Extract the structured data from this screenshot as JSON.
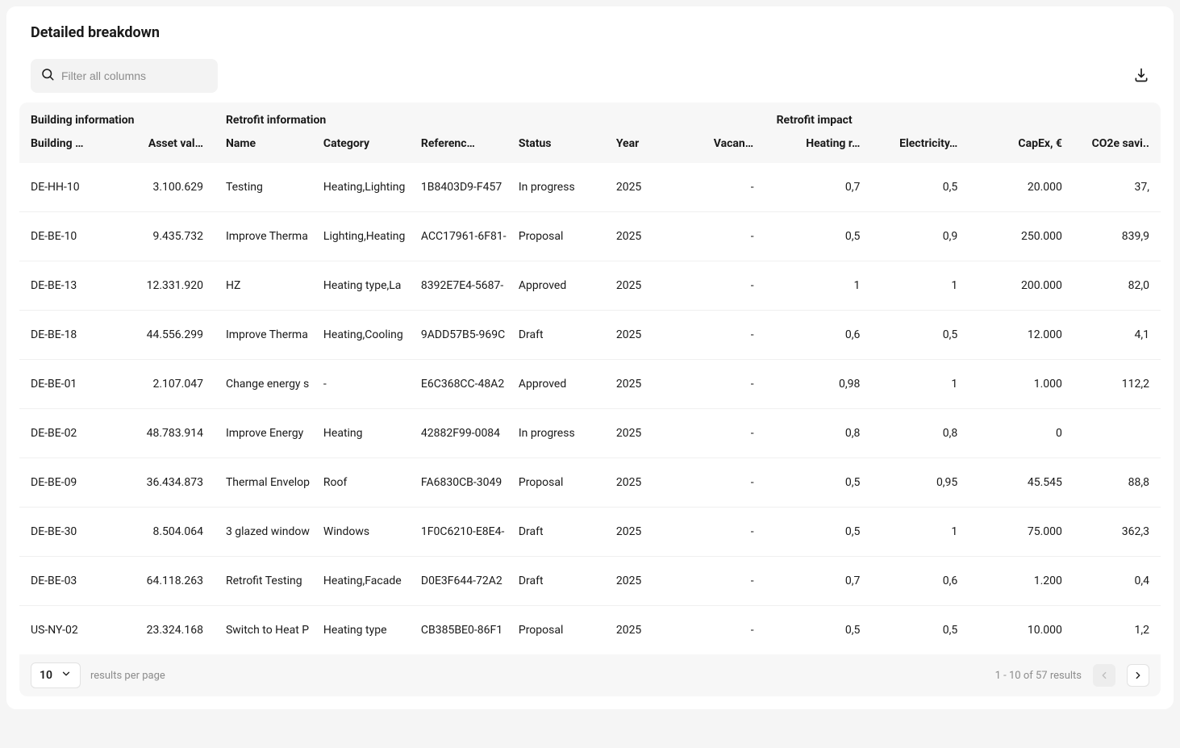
{
  "title": "Detailed breakdown",
  "search": {
    "placeholder": "Filter all columns"
  },
  "groupHeaders": {
    "building": "Building information",
    "retrofit": "Retrofit information",
    "impact": "Retrofit impact"
  },
  "columns": {
    "building": "Building …",
    "asset": "Asset val…",
    "name": "Name",
    "category": "Category",
    "reference": "Referenc…",
    "status": "Status",
    "year": "Year",
    "vacancy": "Vacancy …",
    "heating": "Heating r…",
    "electricity": "Electricity…",
    "capex": "CapEx, €",
    "co2": "CO2e savi.."
  },
  "rows": [
    {
      "building": "DE-HH-10",
      "asset": "3.100.629",
      "name": "Testing",
      "category": "Heating,Lighting",
      "reference": "1B8403D9-F457",
      "status": "In progress",
      "year": "2025",
      "vacancy": "-",
      "heating": "0,7",
      "electricity": "0,5",
      "capex": "20.000",
      "co2": "37,"
    },
    {
      "building": "DE-BE-10",
      "asset": "9.435.732",
      "name": "Improve Therma",
      "category": "Lighting,Heating",
      "reference": "ACC17961-6F81-",
      "status": "Proposal",
      "year": "2025",
      "vacancy": "-",
      "heating": "0,5",
      "electricity": "0,9",
      "capex": "250.000",
      "co2": "839,9"
    },
    {
      "building": "DE-BE-13",
      "asset": "12.331.920",
      "name": "HZ",
      "category": "Heating type,La",
      "reference": "8392E7E4-5687-",
      "status": "Approved",
      "year": "2025",
      "vacancy": "-",
      "heating": "1",
      "electricity": "1",
      "capex": "200.000",
      "co2": "82,0"
    },
    {
      "building": "DE-BE-18",
      "asset": "44.556.299",
      "name": "Improve Therma",
      "category": "Heating,Cooling",
      "reference": "9ADD57B5-969C",
      "status": "Draft",
      "year": "2025",
      "vacancy": "-",
      "heating": "0,6",
      "electricity": "0,5",
      "capex": "12.000",
      "co2": "4,1"
    },
    {
      "building": "DE-BE-01",
      "asset": "2.107.047",
      "name": "Change energy s",
      "category": "-",
      "reference": "E6C368CC-48A2",
      "status": "Approved",
      "year": "2025",
      "vacancy": "-",
      "heating": "0,98",
      "electricity": "1",
      "capex": "1.000",
      "co2": "112,2"
    },
    {
      "building": "DE-BE-02",
      "asset": "48.783.914",
      "name": "Improve Energy",
      "category": "Heating",
      "reference": "42882F99-0084",
      "status": "In progress",
      "year": "2025",
      "vacancy": "-",
      "heating": "0,8",
      "electricity": "0,8",
      "capex": "0",
      "co2": ""
    },
    {
      "building": "DE-BE-09",
      "asset": "36.434.873",
      "name": "Thermal Envelop",
      "category": "Roof",
      "reference": "FA6830CB-3049",
      "status": "Proposal",
      "year": "2025",
      "vacancy": "-",
      "heating": "0,5",
      "electricity": "0,95",
      "capex": "45.545",
      "co2": "88,8"
    },
    {
      "building": "DE-BE-30",
      "asset": "8.504.064",
      "name": "3 glazed window",
      "category": "Windows",
      "reference": "1F0C6210-E8E4-",
      "status": "Draft",
      "year": "2025",
      "vacancy": "-",
      "heating": "0,5",
      "electricity": "1",
      "capex": "75.000",
      "co2": "362,3"
    },
    {
      "building": "DE-BE-03",
      "asset": "64.118.263",
      "name": "Retrofit Testing",
      "category": "Heating,Facade",
      "reference": "D0E3F644-72A2",
      "status": "Draft",
      "year": "2025",
      "vacancy": "-",
      "heating": "0,7",
      "electricity": "0,6",
      "capex": "1.200",
      "co2": "0,4"
    },
    {
      "building": "US-NY-02",
      "asset": "23.324.168",
      "name": "Switch to Heat P",
      "category": "Heating type",
      "reference": "CB385BE0-86F1",
      "status": "Proposal",
      "year": "2025",
      "vacancy": "-",
      "heating": "0,5",
      "electricity": "0,5",
      "capex": "10.000",
      "co2": "1,2"
    }
  ],
  "pagination": {
    "pageSize": "10",
    "label": "results per page",
    "range": "1 -  10 of  57 results"
  }
}
